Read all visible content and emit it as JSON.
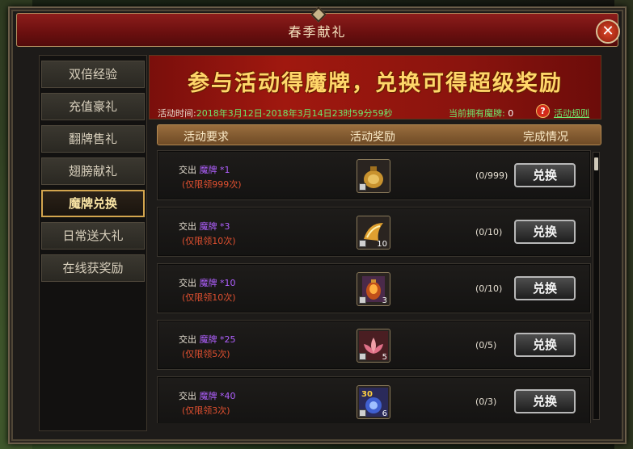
{
  "window": {
    "title": "春季献礼",
    "close_glyph": "✕"
  },
  "sidebar": {
    "items": [
      {
        "label": "双倍经验"
      },
      {
        "label": "充值豪礼"
      },
      {
        "label": "翻牌售礼"
      },
      {
        "label": "翅膀献礼"
      },
      {
        "label": "魔牌兑换",
        "active": true
      },
      {
        "label": "日常送大礼"
      },
      {
        "label": "在线获奖励"
      }
    ]
  },
  "banner": {
    "headline": "参与活动得魔牌，兑换可得超级奖励",
    "time_label": "活动时间:",
    "time_value": "2018年3月12日-2018年3月14日23时59分59秒",
    "owned_label": "当前拥有魔牌:",
    "owned_value": "0",
    "help_glyph": "?",
    "rules_link": "活动规则"
  },
  "columns": {
    "requirement": "活动要求",
    "reward": "活动奖励",
    "status": "完成情况"
  },
  "rows": [
    {
      "give": "交出",
      "item": "魔牌",
      "qty": "*1",
      "limit": "(仅限领999次)",
      "reward_icon": "pouch-icon",
      "reward_count": "",
      "progress": "(0/999)",
      "button": "兑换"
    },
    {
      "give": "交出",
      "item": "魔牌",
      "qty": "*3",
      "limit": "(仅限领10次)",
      "reward_icon": "horn-icon",
      "reward_count": "10",
      "progress": "(0/10)",
      "button": "兑换"
    },
    {
      "give": "交出",
      "item": "魔牌",
      "qty": "*10",
      "limit": "(仅限领10次)",
      "reward_icon": "lantern-icon",
      "reward_count": "3",
      "progress": "(0/10)",
      "button": "兑换"
    },
    {
      "give": "交出",
      "item": "魔牌",
      "qty": "*25",
      "limit": "(仅限领5次)",
      "reward_icon": "lotus-icon",
      "reward_count": "5",
      "progress": "(0/5)",
      "button": "兑换"
    },
    {
      "give": "交出",
      "item": "魔牌",
      "qty": "*40",
      "limit": "(仅限领3次)",
      "reward_icon": "soul-orb-icon",
      "reward_count": "6",
      "reward_badge": "30",
      "progress": "(0/3)",
      "button": "兑换"
    }
  ],
  "colors": {
    "accent_gold": "#ffd76a",
    "title_red": "#8d1d1b",
    "green_text": "#6ee86e",
    "purple_item": "#b060ff",
    "red_limit": "#e05030"
  }
}
